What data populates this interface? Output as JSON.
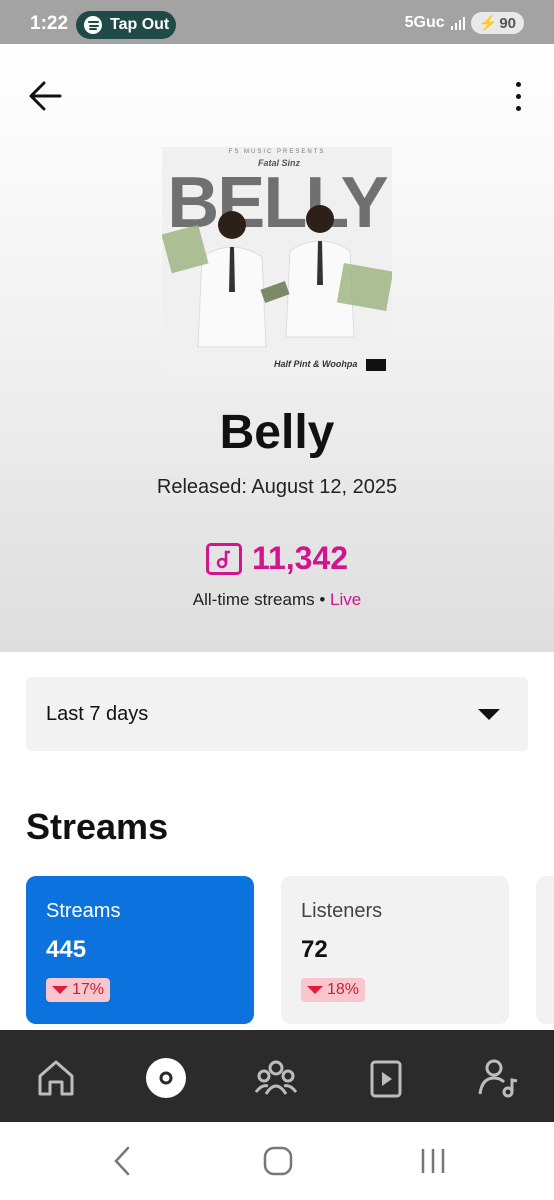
{
  "status_bar": {
    "time": "1:22",
    "media_pill_label": "Tap Out",
    "network": "5Guc",
    "battery": "90"
  },
  "header": {
    "back_icon": "arrow-left-icon",
    "more_icon": "more-vertical-icon"
  },
  "album": {
    "cover_title": "BELLY",
    "cover_presents": "FS MUSIC PRESENTS",
    "cover_fatal": "Fatal Sinz",
    "cover_artists": "Half Pint & Woohpa",
    "title": "Belly",
    "released": "Released: August 12, 2025",
    "stream_count": "11,342",
    "alltime_label": "All-time streams •",
    "live_label": "Live"
  },
  "range_select": {
    "value": "Last 7 days"
  },
  "streams_section": {
    "title": "Streams",
    "cards": [
      {
        "label": "Streams",
        "value": "445",
        "change": "17%",
        "trend": "down"
      },
      {
        "label": "Listeners",
        "value": "72",
        "change": "18%",
        "trend": "down"
      }
    ]
  },
  "colors": {
    "accent_pink": "#d1158d",
    "active_card": "#0c72dd",
    "nav_bg": "#2b2b2b",
    "negative_badge_bg": "#f8c6cc"
  },
  "bottom_nav": {
    "items": [
      "home-icon",
      "music-disc-icon",
      "audience-icon",
      "video-icon",
      "profile-music-icon"
    ],
    "selected_index": 1
  }
}
